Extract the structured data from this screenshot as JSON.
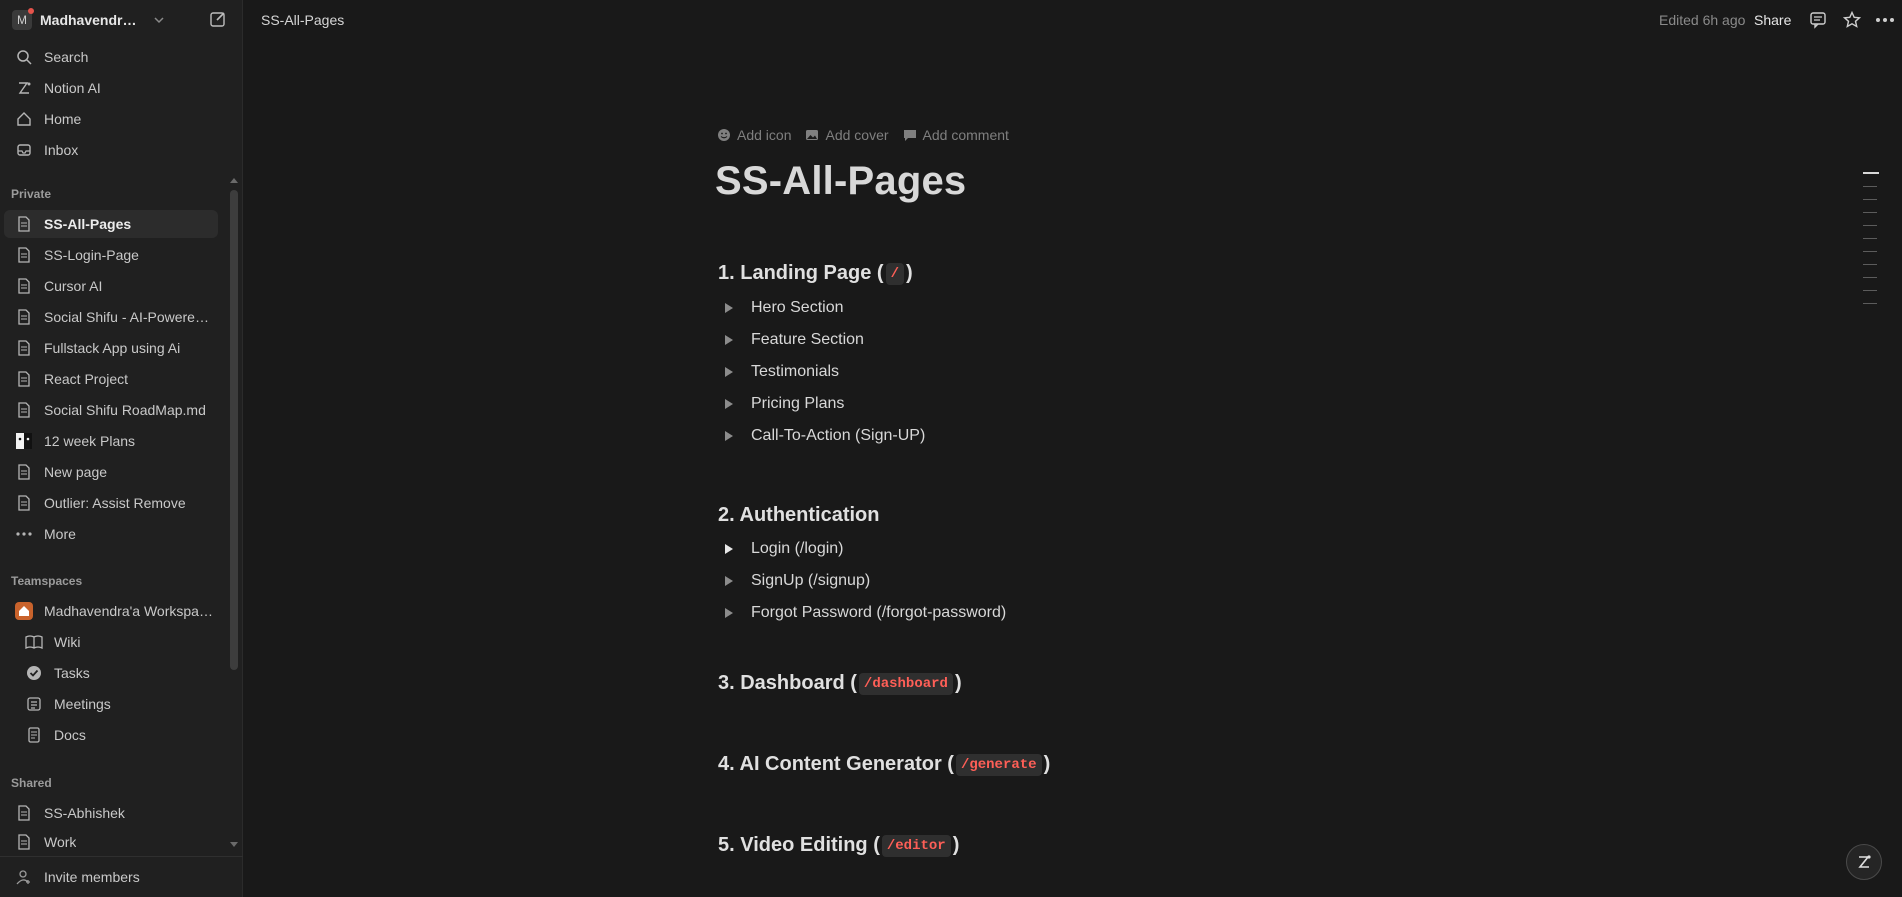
{
  "workspace": {
    "avatar_letter": "M",
    "name": "Madhavendra's Notion"
  },
  "sidebar": {
    "top_items": [
      {
        "label": "Search",
        "icon": "search-icon"
      },
      {
        "label": "Notion AI",
        "icon": "notion-ai-icon"
      },
      {
        "label": "Home",
        "icon": "home-icon"
      },
      {
        "label": "Inbox",
        "icon": "inbox-icon"
      }
    ],
    "private_label": "Private",
    "private_items": [
      {
        "label": "SS-All-Pages",
        "icon": "page-icon",
        "active": true
      },
      {
        "label": "SS-Login-Page",
        "icon": "page-icon"
      },
      {
        "label": "Cursor AI",
        "icon": "page-icon"
      },
      {
        "label": "Social Shifu - AI-Powered Video Editing",
        "icon": "page-icon"
      },
      {
        "label": "Fullstack App using Ai",
        "icon": "page-icon"
      },
      {
        "label": "React Project",
        "icon": "page-icon"
      },
      {
        "label": "Social Shifu RoadMap.md",
        "icon": "page-icon"
      },
      {
        "label": "12 week Plans",
        "icon": "emoji-page-icon"
      },
      {
        "label": "New page",
        "icon": "page-icon"
      },
      {
        "label": "Outlier: Assist Remove",
        "icon": "page-icon"
      },
      {
        "label": "More",
        "icon": "more-dots-icon"
      }
    ],
    "teamspaces_label": "Teamspaces",
    "teamspace_name": "Madhavendra'a Workspace HQ",
    "teamspace_items": [
      {
        "label": "Wiki",
        "icon": "book-icon"
      },
      {
        "label": "Tasks",
        "icon": "check-circle-icon"
      },
      {
        "label": "Meetings",
        "icon": "calendar-list-icon"
      },
      {
        "label": "Docs",
        "icon": "document-icon"
      }
    ],
    "shared_label": "Shared",
    "shared_items": [
      {
        "label": "SS-Abhishek",
        "icon": "page-icon"
      },
      {
        "label": "Work",
        "icon": "page-icon"
      }
    ],
    "invite_label": "Invite members"
  },
  "topbar": {
    "breadcrumb": "SS-All-Pages",
    "edited": "Edited 6h ago",
    "share": "Share"
  },
  "page": {
    "actions": {
      "add_icon": "Add icon",
      "add_cover": "Add cover",
      "add_comment": "Add comment"
    },
    "title": "SS-All-Pages",
    "sections": {
      "s1": {
        "prefix": "1. Landing Page (",
        "code": "/",
        "suffix": ")"
      },
      "s1_items": [
        "Hero Section",
        "Feature Section",
        "Testimonials",
        "Pricing Plans",
        "Call-To-Action (Sign-UP)"
      ],
      "s2": {
        "title": "2. Authentication"
      },
      "s2_items": [
        "Login (/login)",
        "SignUp (/signup)",
        "Forgot Password (/forgot-password)"
      ],
      "s3": {
        "prefix": "3. Dashboard (",
        "code": "/dashboard",
        "suffix": ")"
      },
      "s4": {
        "prefix": "4. AI Content Generator (",
        "code": "/generate",
        "suffix": ")"
      },
      "s5": {
        "prefix": "5. Video Editing (",
        "code": "/editor",
        "suffix": ")"
      }
    }
  },
  "colors": {
    "background": "#191919",
    "sidebar": "#202020",
    "code_text": "#ff5f57",
    "teamspace_icon": "#c9632c"
  }
}
